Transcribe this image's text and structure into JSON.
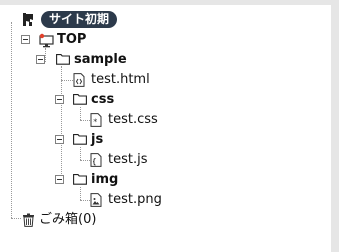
{
  "tree": {
    "root": {
      "label": "サイト初期",
      "icon": "site-root-icon"
    },
    "top": {
      "label": "TOP",
      "icon": "monitor-home-icon"
    },
    "sample": {
      "label": "sample",
      "icon": "folder-icon"
    },
    "files": {
      "test_html": {
        "label": "test.html",
        "icon": "html-file-icon"
      },
      "css": {
        "label": "css",
        "icon": "folder-icon"
      },
      "test_css": {
        "label": "test.css",
        "icon": "css-file-icon"
      },
      "js": {
        "label": "js",
        "icon": "folder-icon"
      },
      "test_js": {
        "label": "test.js",
        "icon": "js-file-icon"
      },
      "img": {
        "label": "img",
        "icon": "folder-icon"
      },
      "test_png": {
        "label": "test.png",
        "icon": "image-file-icon"
      }
    },
    "trash": {
      "label": "ごみ箱(0)",
      "icon": "trash-icon"
    }
  },
  "colors": {
    "badge_bg": "#2c3a4b",
    "badge_text": "#ffffff",
    "frame": "#e6e6e6",
    "guides": "#9a9a9a"
  }
}
